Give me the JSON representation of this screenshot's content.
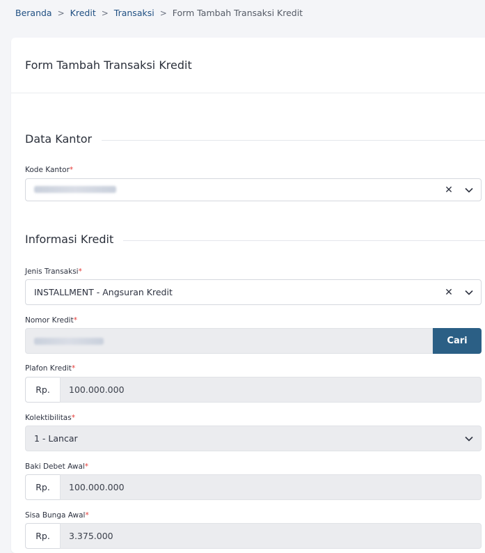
{
  "breadcrumb": {
    "items": [
      "Beranda",
      "Kredit",
      "Transaksi"
    ],
    "current": "Form Tambah Transaksi Kredit",
    "separator": ">"
  },
  "card": {
    "title": "Form Tambah Transaksi Kredit"
  },
  "section_kantor": {
    "title": "Data Kantor",
    "kode_kantor": {
      "label": "Kode Kantor",
      "required": "*",
      "value_redacted": true
    }
  },
  "section_kredit": {
    "title": "Informasi Kredit",
    "jenis_transaksi": {
      "label": "Jenis Transaksi",
      "required": "*",
      "value": "INSTALLMENT - Angsuran Kredit"
    },
    "nomor_kredit": {
      "label": "Nomor Kredit",
      "required": "*",
      "value_redacted": true,
      "button": "Cari"
    },
    "plafon_kredit": {
      "label": "Plafon Kredit",
      "required": "*",
      "prefix": "Rp.",
      "value": "100.000.000"
    },
    "kolektibilitas": {
      "label": "Kolektibilitas",
      "required": "*",
      "value": "1 - Lancar"
    },
    "baki_debet_awal": {
      "label": "Baki Debet Awal",
      "required": "*",
      "prefix": "Rp.",
      "value": "100.000.000"
    },
    "sisa_bunga_awal": {
      "label": "Sisa Bunga Awal",
      "required": "*",
      "prefix": "Rp.",
      "value": "3.375.000"
    }
  },
  "icons": {
    "clear": "x-icon",
    "dropdown": "chevron-down-icon"
  },
  "colors": {
    "primary_button": "#2b5f85",
    "link": "#1f4f82",
    "required": "#e53935"
  }
}
